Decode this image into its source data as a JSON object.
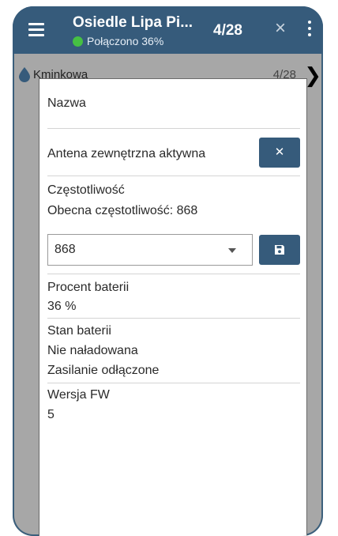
{
  "app_bar": {
    "title": "Osiedle Lipa Pi...",
    "status_text": "Połączono 36%",
    "counter": "4/28",
    "close_glyph": "×",
    "colors": {
      "bar": "#365b7b",
      "status_dot": "#46c043"
    }
  },
  "background_row": {
    "label": "Kminkowa",
    "count": "4/28",
    "chevron": "❯",
    "icon": "water-drop-icon"
  },
  "dialog": {
    "name_label": "Nazwa",
    "antenna_label": "Antena zewnętrzna aktywna",
    "antenna_button_glyph": "✕",
    "frequency_label": "Częstotliwość",
    "current_frequency": "Obecna częstotliwość: 868",
    "frequency_select_value": "868",
    "save_icon": "floppy-disk-icon",
    "battery_percent_label": "Procent baterii",
    "battery_percent_value": "36 %",
    "battery_state_label": "Stan baterii",
    "battery_state_value": "Nie naładowana",
    "power_state_value": "Zasilanie odłączone",
    "fw_label": "Wersja FW",
    "fw_value": "5"
  }
}
